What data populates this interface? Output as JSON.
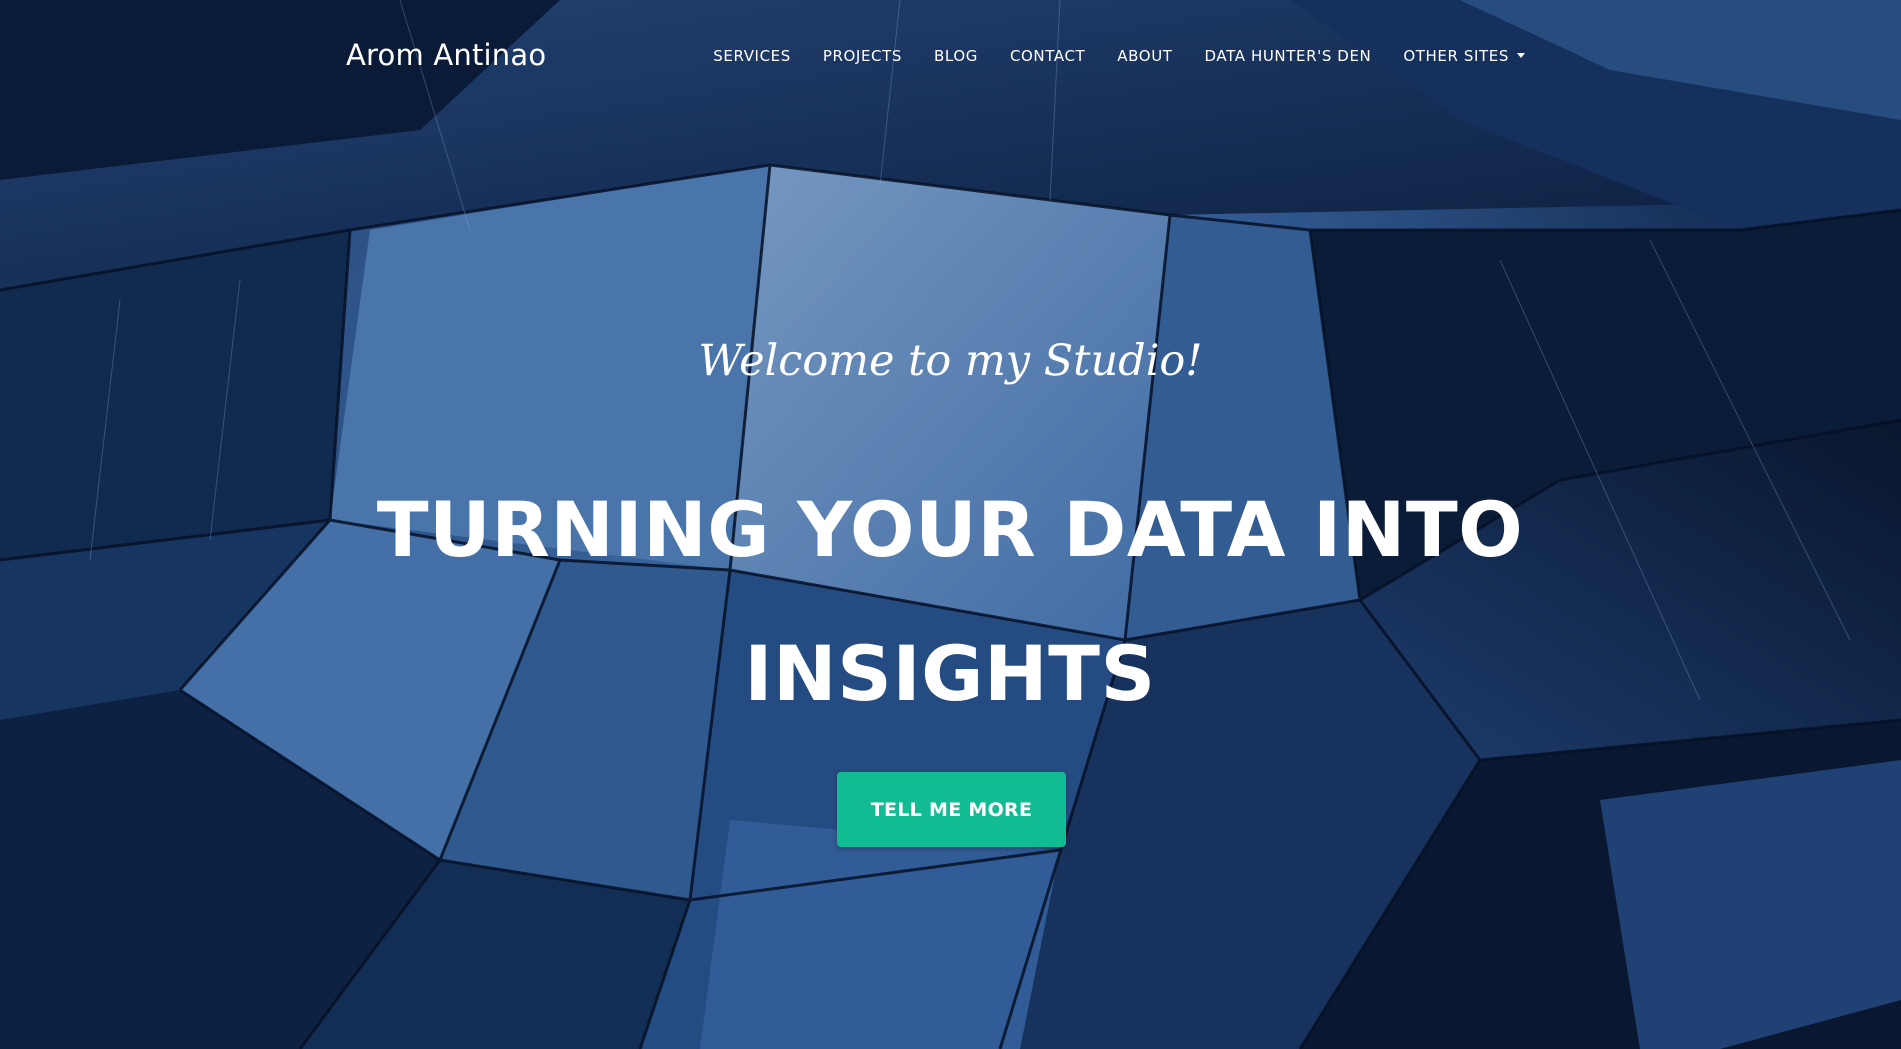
{
  "navbar": {
    "brand": "Arom Antinao",
    "items": [
      {
        "label": "SERVICES"
      },
      {
        "label": "PROJECTS"
      },
      {
        "label": "BLOG"
      },
      {
        "label": "CONTACT"
      },
      {
        "label": "ABOUT"
      },
      {
        "label": "DATA HUNTER'S DEN"
      },
      {
        "label": "OTHER SITES"
      }
    ]
  },
  "hero": {
    "subheading": "Welcome to my Studio!",
    "heading": "TURNING YOUR DATA INTO INSIGHTS",
    "button_label": "TELL ME MORE"
  },
  "colors": {
    "accent": "#12bc93",
    "text": "#ffffff",
    "background": "#1f3f6f"
  }
}
